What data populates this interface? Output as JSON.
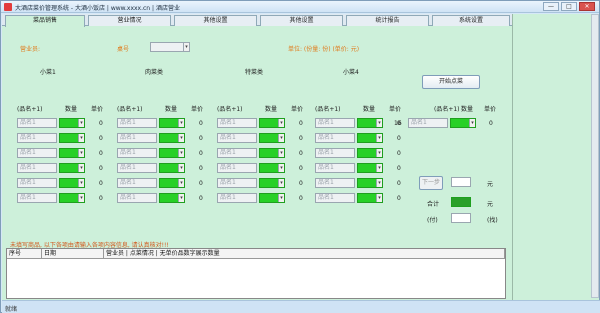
{
  "window": {
    "title": "大酒店菜价管理系统 - 大酒小饭店 | www.xxxx.cn | 酒店营业",
    "minimize": "—",
    "maximize": "□",
    "close": "✕"
  },
  "tabs": [
    {
      "label": "菜品销售"
    },
    {
      "label": "营业情况"
    },
    {
      "label": "其他设置"
    },
    {
      "label": "其他设置"
    },
    {
      "label": "统计报告"
    },
    {
      "label": "系统设置"
    }
  ],
  "form": {
    "waiter_label": "营业员:",
    "table_label": "桌号",
    "unit_note": "单位: (份量: 份) (单价: 元)",
    "col_labels": [
      "小菜1",
      "肉菜类",
      "特菜类",
      "小菜4"
    ],
    "start_button": "开始点菜",
    "col_headers": [
      "(品名+1)",
      "数量",
      "单价"
    ],
    "select_placeholder": "品名1",
    "price_value": "0",
    "extra_item_placeholder": "品名1",
    "extra_price": "16",
    "right_btn_1": "下一步",
    "right_field_1_label": "元",
    "right_total_label": "合计",
    "right_total_unit": "元",
    "right_pay_label": "(付)",
    "right_pay_unit": "(找)",
    "hint_text": "未填写商品, 以下各项由请输入各项内容信息, 请认真核对!!!"
  },
  "grid": {
    "headers": [
      "序号",
      "日期",
      "营业员 | 点菜情况 | 无单价品数字展示数量"
    ]
  },
  "status": {
    "text": "就绪"
  },
  "colors": {
    "accent_green": "#27d027",
    "panel_bg": "#cdf0da",
    "orange": "#e07a1a"
  }
}
